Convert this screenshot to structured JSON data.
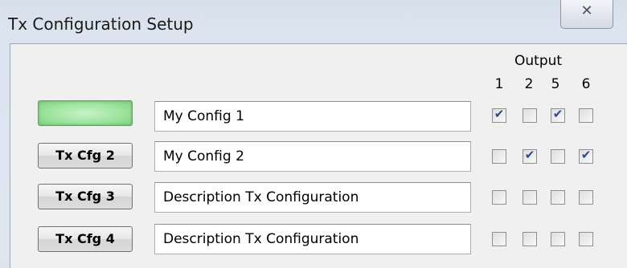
{
  "window": {
    "title": "Tx Configuration Setup",
    "close_icon": "✕"
  },
  "output": {
    "title": "Output",
    "columns": [
      "1",
      "2",
      "5",
      "6"
    ]
  },
  "rows": [
    {
      "button_label": "",
      "active": true,
      "description": "My Config 1",
      "outputs": [
        true,
        false,
        true,
        false
      ]
    },
    {
      "button_label": "Tx Cfg 2",
      "active": false,
      "description": "My Config 2",
      "outputs": [
        false,
        true,
        false,
        true
      ]
    },
    {
      "button_label": "Tx Cfg 3",
      "active": false,
      "description": "Description Tx Configuration",
      "outputs": [
        false,
        false,
        false,
        false
      ]
    },
    {
      "button_label": "Tx Cfg 4",
      "active": false,
      "description": "Description Tx Configuration",
      "outputs": [
        false,
        false,
        false,
        false
      ]
    }
  ],
  "colors": {
    "active_button": "#9be39b",
    "check": "#2c4a8a"
  }
}
